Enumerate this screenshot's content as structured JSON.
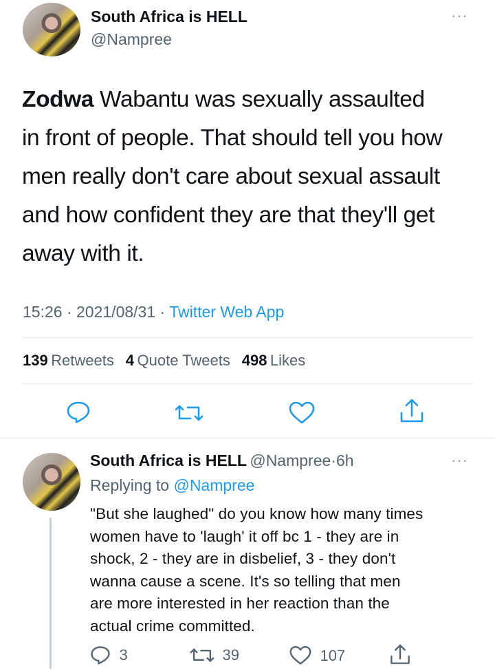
{
  "tweet": {
    "display_name": "South Africa is HELL",
    "handle": "@Nampree",
    "more": "···",
    "text_bold": "Zodwa",
    "text_line1_rest": " Wabantu was sexually assaulted",
    "text_line2": "in front of people. That should tell you how",
    "text_line3": "men really don't care about sexual assault",
    "text_line4": "and how confident they are that they'll get",
    "text_line5": "away with it.",
    "time": "15:26",
    "sep1": "·",
    "date": "2021/08/31",
    "sep2": "·",
    "source": "Twitter Web App",
    "stats": {
      "retweets_count": "139",
      "retweets_label": "Retweets",
      "quotes_count": "4",
      "quotes_label": "Quote Tweets",
      "likes_count": "498",
      "likes_label": "Likes"
    }
  },
  "reply": {
    "display_name": "South Africa is HELL",
    "handle": "@Nampree",
    "dot": "·",
    "age": "6h",
    "more": "···",
    "replying_prefix": "Replying to",
    "replying_to": "@Nampree",
    "lines": [
      "\"But she laughed\" do you know how many times",
      "women have to 'laugh' it off bc 1 - they are in",
      "shock, 2 - they are in disbelief, 3 - they don't",
      "wanna cause a scene. It's so telling that men",
      "are more interested in her reaction than the",
      "actual crime committed."
    ],
    "reply_count": "3",
    "retweet_count": "39",
    "like_count": "107"
  },
  "icons": {
    "reply": "reply-icon",
    "retweet": "retweet-icon",
    "like": "heart-icon",
    "share": "share-icon",
    "more": "more-icon"
  },
  "colors": {
    "link": "#1d9bf0",
    "secondary_text": "#536471",
    "icon": "#1d9bf0",
    "reply_icon": "#536471"
  }
}
